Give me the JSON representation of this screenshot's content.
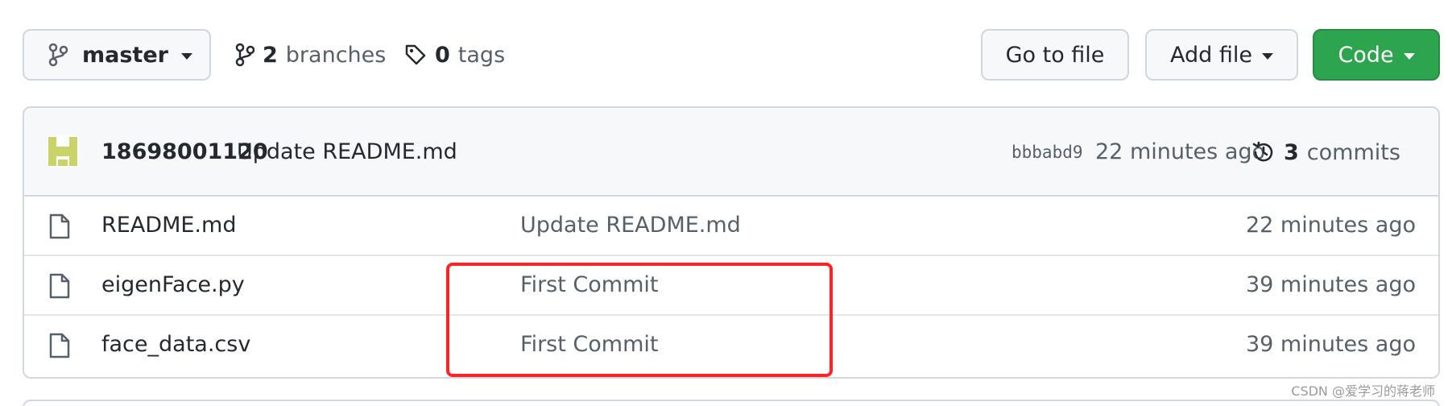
{
  "toolbar": {
    "branch_label": "master",
    "branches_count": "2",
    "branches_label": "branches",
    "tags_count": "0",
    "tags_label": "tags",
    "goto_file_label": "Go to file",
    "add_file_label": "Add file",
    "code_label": "Code"
  },
  "commit": {
    "author": "18698001120",
    "message": "Update README.md",
    "sha": "bbbabd9",
    "time": "22 minutes ago",
    "commits_count": "3",
    "commits_label": "commits"
  },
  "files": [
    {
      "name": "README.md",
      "commit_message": "Update README.md",
      "time": "22 minutes ago"
    },
    {
      "name": "eigenFace.py",
      "commit_message": "First Commit",
      "time": "39 minutes ago"
    },
    {
      "name": "face_data.csv",
      "commit_message": "First Commit",
      "time": "39 minutes ago"
    }
  ],
  "watermark": "CSDN @爱学习的蒋老师",
  "colors": {
    "code_button": "#2da44e",
    "highlight_border": "#ff2222",
    "avatar": "#c9d36a"
  },
  "icons": {
    "branch": "git-branch-icon",
    "tag": "tag-icon",
    "history": "history-icon",
    "file": "file-icon"
  }
}
